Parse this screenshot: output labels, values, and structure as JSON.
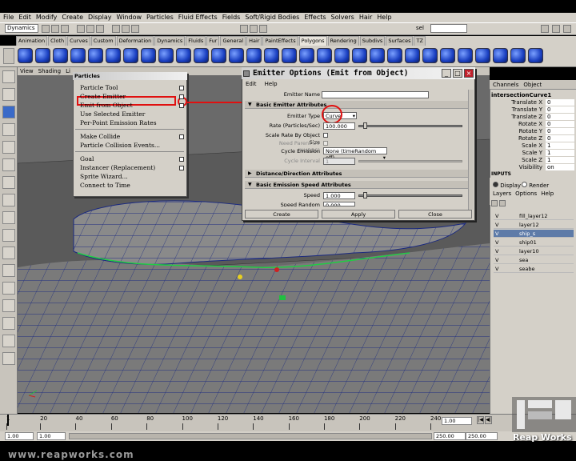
{
  "menubar": [
    "File",
    "Edit",
    "Modify",
    "Create",
    "Display",
    "Window",
    "Particles",
    "Fluid Effects",
    "Fields",
    "Soft/Rigid Bodies",
    "Effects",
    "Solvers",
    "Hair",
    "Help"
  ],
  "status": {
    "mode": "Dynamics",
    "sel_label": "sel"
  },
  "shelf_tabs": [
    "Animation",
    "Cloth",
    "Curves",
    "Custom",
    "Deformation",
    "Dynamics",
    "Fluids",
    "Fur",
    "General",
    "Hair",
    "PaintEffects",
    "Polygons",
    "Rendering",
    "Subdivs",
    "Surfaces",
    "TZ"
  ],
  "shelf_active_tab": "Polygons",
  "viewport_menu": [
    "View",
    "Shading",
    "Li"
  ],
  "particles_menu": {
    "title": "Particles",
    "groups": [
      [
        {
          "label": "Particle Tool",
          "opt": true
        },
        {
          "label": "Create Emitter",
          "opt": true
        },
        {
          "label": "Emit from Object",
          "opt": true
        },
        {
          "label": "Use Selected Emitter",
          "opt": false
        },
        {
          "label": "Per-Point Emission Rates",
          "opt": false
        }
      ],
      [
        {
          "label": "Make Collide",
          "opt": true
        },
        {
          "label": "Particle Collision Events...",
          "opt": false
        }
      ],
      [
        {
          "label": "Goal",
          "opt": true
        },
        {
          "label": "Instancer (Replacement)",
          "opt": true
        },
        {
          "label": "Sprite Wizard...",
          "opt": false
        },
        {
          "label": "Connect to Time",
          "opt": false
        }
      ]
    ]
  },
  "emitter_dialog": {
    "title": "Emitter Options (Emit from Object)",
    "menu": [
      "Edit",
      "Help"
    ],
    "name_label": "Emitter Name",
    "name_value": "",
    "basic_section": "Basic Emitter Attributes",
    "type_label": "Emitter Type",
    "type_value": "Curve",
    "rate_label": "Rate (Particles/Sec)",
    "rate_value": "100.000",
    "scale_rate_label": "Scale Rate By Object Size",
    "scale_rate_pp_label": "Need Parent UV (NURBS)",
    "cycle_label": "Cycle Emission",
    "cycle_value": "None (timeRandom off)",
    "cycle_interval_label": "Cycle Interval",
    "cycle_interval_value": "1",
    "distance_section": "Distance/Direction Attributes",
    "speed_section": "Basic Emission Speed Attributes",
    "speed_label": "Speed",
    "speed_value": "1.000",
    "speed_random_label": "Speed Random",
    "speed_random_value": "0.000",
    "buttons": {
      "create": "Create",
      "apply": "Apply",
      "close": "Close"
    }
  },
  "channel_box": {
    "tabs": [
      "Channels",
      "Object"
    ],
    "object": "intersectionCurve1",
    "rows": [
      {
        "label": "Translate X",
        "value": "0"
      },
      {
        "label": "Translate Y",
        "value": "0"
      },
      {
        "label": "Translate Z",
        "value": "0"
      },
      {
        "label": "Rotate X",
        "value": "0"
      },
      {
        "label": "Rotate Y",
        "value": "0"
      },
      {
        "label": "Rotate Z",
        "value": "0"
      },
      {
        "label": "Scale X",
        "value": "1"
      },
      {
        "label": "Scale Y",
        "value": "1"
      },
      {
        "label": "Scale Z",
        "value": "1"
      },
      {
        "label": "Visibility",
        "value": "on"
      }
    ],
    "inputs_label": "INPUTS"
  },
  "layers": {
    "display_label": "Display",
    "render_label": "Render",
    "menu": [
      "Layers",
      "Options",
      "Help"
    ],
    "items": [
      {
        "vis": "V",
        "name": "fill_layer12",
        "selected": false
      },
      {
        "vis": "V",
        "name": "layer12",
        "selected": false
      },
      {
        "vis": "V",
        "name": "ship_s",
        "selected": true
      },
      {
        "vis": "V",
        "name": "ship01",
        "selected": false
      },
      {
        "vis": "V",
        "name": "layer10",
        "selected": false
      },
      {
        "vis": "V",
        "name": "sea",
        "selected": false
      },
      {
        "vis": "V",
        "name": "seabe",
        "selected": false
      }
    ]
  },
  "timeline": {
    "ticks": [
      "1",
      "20",
      "40",
      "60",
      "80",
      "100",
      "120",
      "140",
      "160",
      "180",
      "200",
      "220",
      "240"
    ],
    "current": "1.00"
  },
  "range": {
    "start": "1.00",
    "start2": "1.00",
    "end": "250.00",
    "end2": "250.00"
  },
  "watermark": {
    "url": "www.reapworks.com",
    "logo": "Reap Works"
  },
  "colors": {
    "accent_red": "#e01010",
    "selection": "#5e7ba8"
  }
}
